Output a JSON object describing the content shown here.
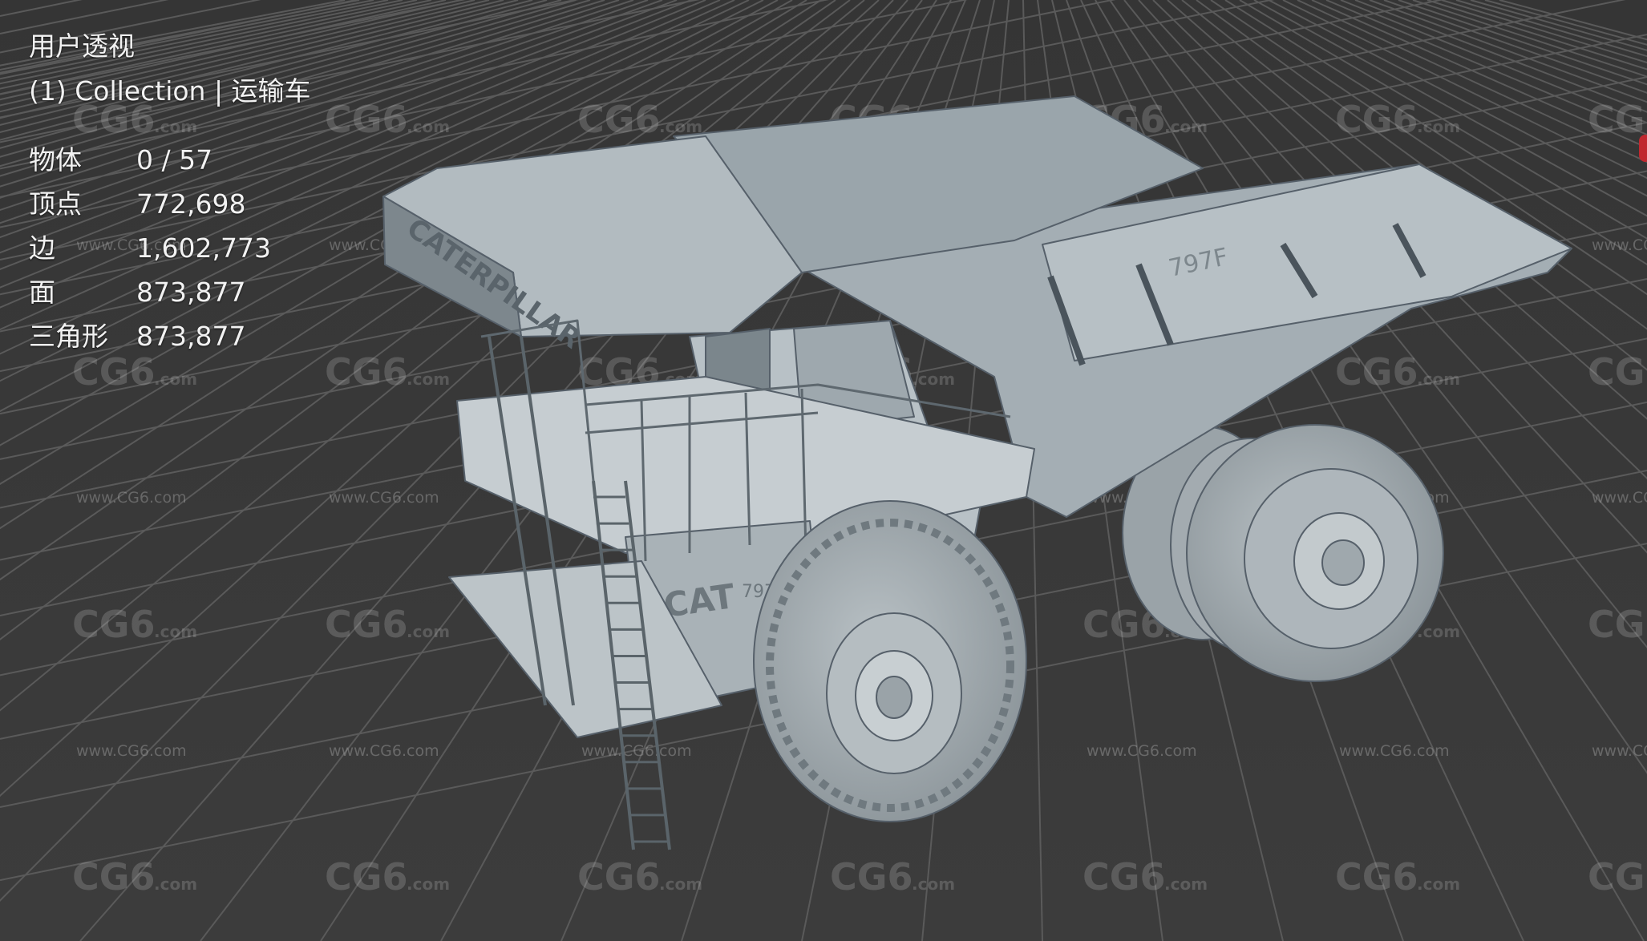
{
  "viewport": {
    "view_name": "用户透视",
    "collection_line": "(1) Collection | 运输车",
    "stats": [
      {
        "label": "物体",
        "value": "0 / 57"
      },
      {
        "label": "顶点",
        "value": "772,698"
      },
      {
        "label": "边",
        "value": "1,602,773"
      },
      {
        "label": "面",
        "value": "873,877"
      },
      {
        "label": "三角形",
        "value": "873,877"
      }
    ]
  },
  "model": {
    "hood_text": "CAT",
    "model_badge": "797F",
    "canopy_text": "CATERPILLAR"
  },
  "watermark": {
    "logo": "CG6",
    "logo_suffix": ".com",
    "url": "www.CG6.com"
  },
  "colors": {
    "background": "#3a3a3a",
    "grid": "#5a5a5a",
    "model": "#a9b4ba",
    "text": "#f2f2f2"
  }
}
